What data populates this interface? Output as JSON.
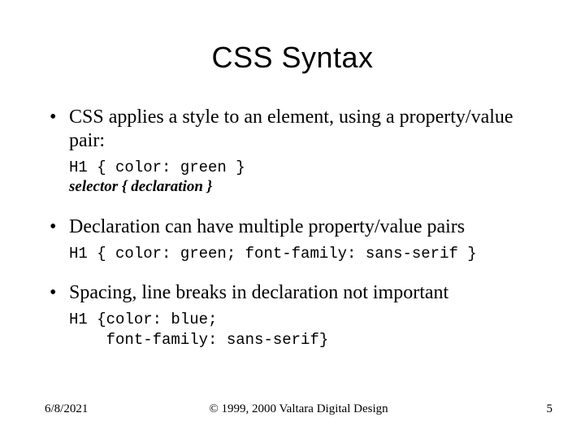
{
  "title": "CSS Syntax",
  "bullets": {
    "b1": "CSS applies a style to an element, using a property/value pair:",
    "code1": "H1 { color: green }",
    "annot1": "selector { declaration }",
    "b2": "Declaration can have multiple property/value pairs",
    "code2": "H1 { color: green; font-family: sans-serif }",
    "b3": "Spacing, line breaks in declaration not important",
    "code3": "H1 {color: blue;\n    font-family: sans-serif}"
  },
  "footer": {
    "date": "6/8/2021",
    "copyright": "© 1999, 2000 Valtara Digital Design",
    "page": "5"
  }
}
